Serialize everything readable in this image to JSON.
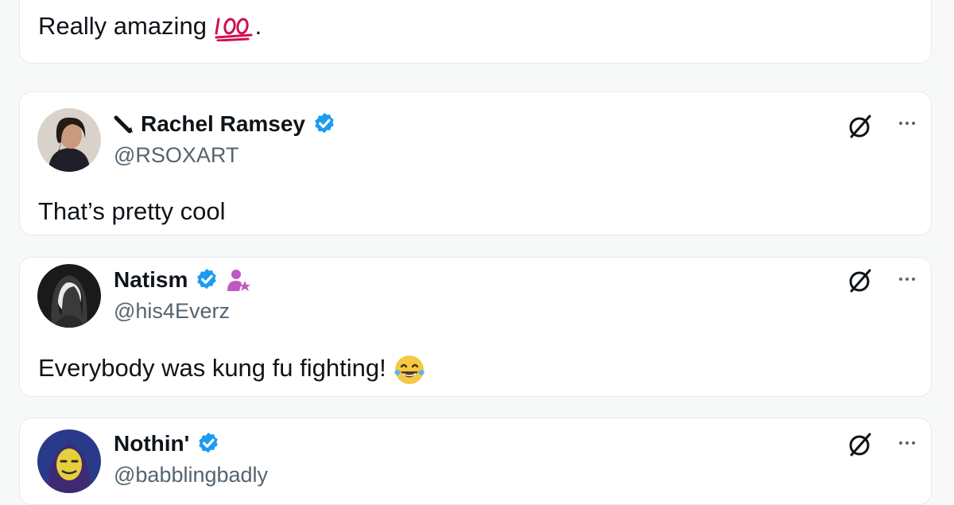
{
  "posts": [
    {
      "text": "Really amazing",
      "trailing": "."
    },
    {
      "name": "Rachel Ramsey",
      "handle": "@RSOXART",
      "text": "That’s pretty cool"
    },
    {
      "name": "Natism",
      "handle": "@his4Everz",
      "text": "Everybody was kung fu fighting!"
    },
    {
      "name": "Nothin'",
      "handle": "@babblingbadly",
      "text": ""
    }
  ],
  "icons": {
    "emoji_1": "hundred-points-emoji",
    "emoji_3": "tears-of-joy-emoji",
    "pen": "pen-icon",
    "grok": "slashed-circle-icon",
    "more": "more-options-icon",
    "verified": "verified-badge-icon",
    "user_star": "user-star-icon"
  },
  "colors": {
    "verified": "#1d9bf0",
    "handle": "#536471",
    "emoji_100": "#d0104c",
    "user_star": "#c05ac2"
  }
}
